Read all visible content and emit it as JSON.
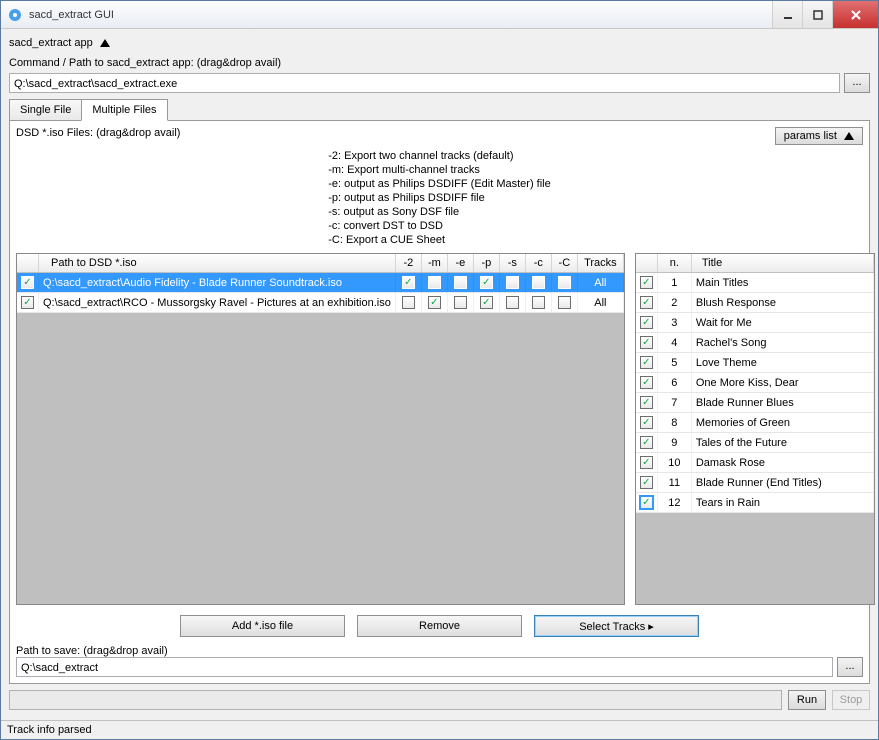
{
  "window": {
    "title": "sacd_extract GUI"
  },
  "section": {
    "app_label": "sacd_extract app",
    "command_label": "Command / Path to sacd_extract app: (drag&drop avail)",
    "command_value": "Q:\\sacd_extract\\sacd_extract.exe"
  },
  "tabs": {
    "single": "Single File",
    "multiple": "Multiple Files"
  },
  "iso_label": "DSD *.iso Files: (drag&drop avail)",
  "params_btn": "params list",
  "help_lines": {
    "l0": "-2: Export two channel tracks (default)",
    "l1": "-m: Export multi-channel tracks",
    "l2": "-e: output as Philips DSDIFF (Edit Master) file",
    "l3": "-p: output as Philips DSDIFF file",
    "l4": "-s: output as Sony DSF file",
    "l5": "-c: convert DST to DSD",
    "l6": "-C: Export a CUE Sheet"
  },
  "left_cols": {
    "path": "Path to DSD *.iso",
    "c2": "-2",
    "cm": "-m",
    "ce": "-e",
    "cp": "-p",
    "cs": "-s",
    "cc": "-c",
    "cC": "-C",
    "tracks": "Tracks"
  },
  "left_rows": [
    {
      "path": "Q:\\sacd_extract\\Audio Fidelity - Blade Runner Soundtrack.iso",
      "row_checked": true,
      "c2": true,
      "cm": false,
      "ce": false,
      "cp": true,
      "cs": false,
      "cc": false,
      "cC": false,
      "tracks": "All",
      "selected": true
    },
    {
      "path": "Q:\\sacd_extract\\RCO - Mussorgsky Ravel - Pictures at an exhibition.iso",
      "row_checked": true,
      "c2": false,
      "cm": true,
      "ce": false,
      "cp": true,
      "cs": false,
      "cc": false,
      "cC": false,
      "tracks": "All",
      "selected": false
    }
  ],
  "right_cols": {
    "n": "n.",
    "title": "Title"
  },
  "tracks": [
    {
      "n": "1",
      "title": "Main Titles"
    },
    {
      "n": "2",
      "title": "Blush Response"
    },
    {
      "n": "3",
      "title": "Wait for Me"
    },
    {
      "n": "4",
      "title": "Rachel's Song"
    },
    {
      "n": "5",
      "title": "Love Theme"
    },
    {
      "n": "6",
      "title": "One More Kiss, Dear"
    },
    {
      "n": "7",
      "title": "Blade Runner Blues"
    },
    {
      "n": "8",
      "title": "Memories of Green"
    },
    {
      "n": "9",
      "title": "Tales of the Future"
    },
    {
      "n": "10",
      "title": "Damask Rose"
    },
    {
      "n": "11",
      "title": "Blade Runner (End Titles)"
    },
    {
      "n": "12",
      "title": "Tears in Rain"
    }
  ],
  "buttons": {
    "add": "Add *.iso file",
    "remove": "Remove",
    "select_tracks": "Select Tracks ▸"
  },
  "save": {
    "label": "Path to save: (drag&drop avail)",
    "value": "Q:\\sacd_extract"
  },
  "run_btn": "Run",
  "stop_btn": "Stop",
  "status": "Track info parsed"
}
